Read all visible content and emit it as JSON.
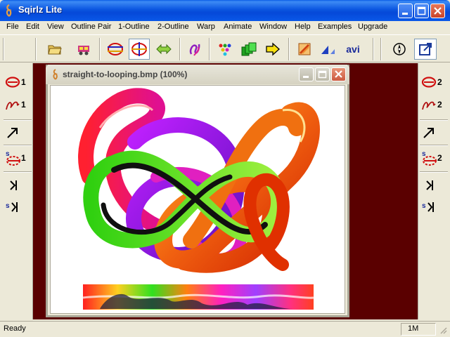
{
  "window": {
    "title": "Sqirlz Lite"
  },
  "menu": [
    "File",
    "Edit",
    "View",
    "Outline Pair",
    "1-Outline",
    "2-Outline",
    "Warp",
    "Animate",
    "Window",
    "Help",
    "Examples",
    "Upgrade"
  ],
  "toolbar": {
    "avi_label": "avi",
    "tools": [
      "open-folder-icon",
      "load-pair-icon",
      "outline-1-icon",
      "outline-2-icon",
      "swap-arrows-icon",
      "spiral-icon",
      "dots-icon",
      "frames-icon",
      "next-arrow-icon",
      "brush-icon",
      "triangle-icon",
      "avi-icon",
      "compass-icon",
      "export-icon"
    ]
  },
  "left_panel": {
    "outline_count": "1",
    "curve_count": "1",
    "s_count": "1"
  },
  "right_panel": {
    "outline_count": "2",
    "curve_count": "2",
    "s_count": "2"
  },
  "side_letter": "s",
  "child_window": {
    "title": "straight-to-looping.bmp  (100%)"
  },
  "status": {
    "text": "Ready",
    "memory": "1M"
  },
  "colors": {
    "titlebar": "#0a58e8",
    "workspace": "#5a0000",
    "face": "#ece9d8"
  }
}
